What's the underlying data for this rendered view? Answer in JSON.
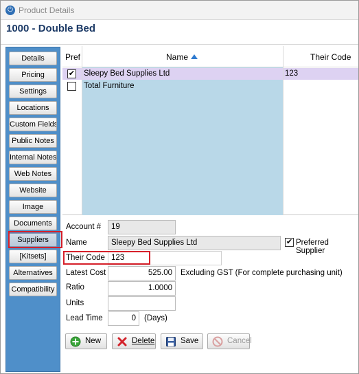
{
  "window": {
    "title": "Product Details",
    "product_heading": "1000 - Double Bed"
  },
  "sidebar": {
    "items": [
      {
        "label": "Details"
      },
      {
        "label": "Pricing"
      },
      {
        "label": "Settings"
      },
      {
        "label": "Locations"
      },
      {
        "label": "Custom Fields"
      },
      {
        "label": "Public Notes"
      },
      {
        "label": "Internal Notes"
      },
      {
        "label": "Web Notes"
      },
      {
        "label": "Website"
      },
      {
        "label": "Image"
      },
      {
        "label": "Documents"
      },
      {
        "label": "Suppliers"
      },
      {
        "label": "[Kitsets]"
      },
      {
        "label": "Alternatives"
      },
      {
        "label": "Compatibility"
      }
    ],
    "active": "Suppliers"
  },
  "grid": {
    "columns": {
      "pref": "Pref",
      "name": "Name",
      "code": "Their Code"
    },
    "rows": [
      {
        "pref": true,
        "name": "Sleepy Bed Supplies Ltd",
        "code": "123"
      },
      {
        "pref": false,
        "name": "Total Furniture",
        "code": ""
      }
    ]
  },
  "form": {
    "account_label": "Account #",
    "account_value": "19",
    "name_label": "Name",
    "name_value": "Sleepy Bed Supplies Ltd",
    "preferred_label": "Preferred Supplier",
    "preferred_checked": true,
    "code_label": "Their Code",
    "code_value": "123",
    "latest_cost_label": "Latest Cost",
    "latest_cost_value": "525.00",
    "latest_cost_note": "Excluding GST (For complete purchasing unit)",
    "ratio_label": "Ratio",
    "ratio_value": "1.0000",
    "units_label": "Units",
    "units_value": "",
    "lead_time_label": "Lead Time",
    "lead_time_value": "0",
    "lead_time_unit": "(Days)"
  },
  "actions": {
    "new": "New",
    "delete": "Delete",
    "save": "Save",
    "cancel": "Cancel"
  },
  "icons": {
    "app": "power-icon",
    "new": "plus-circle-icon",
    "delete": "x-icon",
    "save": "floppy-disk-icon",
    "cancel": "no-entry-icon",
    "sort": "sort-ascending-icon",
    "checkmark": "check-icon"
  },
  "colors": {
    "sidebar": "#4f8fc9",
    "name_column": "#b9d8e8",
    "selected_row": "#ddd2f2",
    "highlight": "#d6202a",
    "heading": "#1c3a66"
  }
}
